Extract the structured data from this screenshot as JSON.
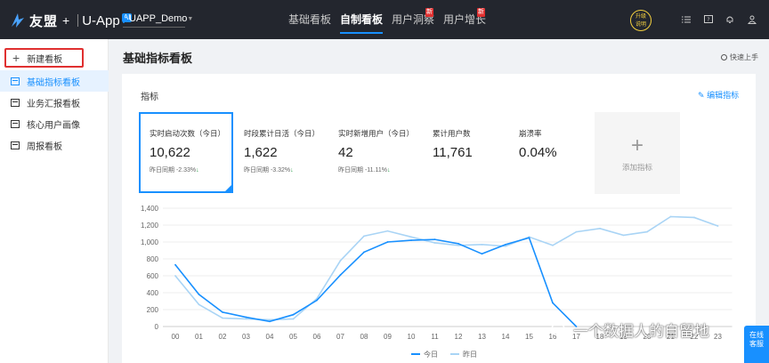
{
  "header": {
    "brand": "友盟",
    "plus": "+",
    "product": "U-App",
    "ai_badge": "AI",
    "app_selector": "UAPP_Demo",
    "nav": [
      {
        "label": "基础看板",
        "active": false,
        "new": false
      },
      {
        "label": "自制看板",
        "active": true,
        "new": false
      },
      {
        "label": "用户洞察",
        "active": false,
        "new": true
      },
      {
        "label": "用户增长",
        "active": false,
        "new": true
      }
    ],
    "new_badge": "新",
    "upgrade_line1": "升级",
    "upgrade_line2": "说明",
    "icons": [
      "list-icon",
      "help-icon",
      "bell-icon",
      "user-icon"
    ]
  },
  "sidebar": {
    "new_board": "新建看板",
    "items": [
      {
        "label": "基础指标看板",
        "active": true
      },
      {
        "label": "业务汇报看板",
        "active": false
      },
      {
        "label": "核心用户画像",
        "active": false
      },
      {
        "label": "周报看板",
        "active": false
      }
    ]
  },
  "main": {
    "title": "基础指标看板",
    "quick_start": "快速上手",
    "section_label": "指标",
    "edit_label": "编辑指标",
    "add_metric": "添加指标",
    "metrics": [
      {
        "name": "实时启动次数（今日）",
        "value": "10,622",
        "cmp_label": "昨日同期",
        "cmp_value": "-2.33%",
        "selected": true
      },
      {
        "name": "时段累计日活（今日）",
        "value": "1,622",
        "cmp_label": "昨日同期",
        "cmp_value": "-3.32%",
        "selected": false
      },
      {
        "name": "实时新增用户（今日）",
        "value": "42",
        "cmp_label": "昨日同期",
        "cmp_value": "-11.11%",
        "selected": false
      },
      {
        "name": "累计用户数",
        "value": "11,761",
        "cmp_label": "",
        "cmp_value": "",
        "selected": false
      },
      {
        "name": "崩溃率",
        "value": "0.04%",
        "cmp_label": "",
        "cmp_value": "",
        "selected": false
      }
    ]
  },
  "chart_data": {
    "type": "line",
    "categories": [
      "00",
      "01",
      "02",
      "03",
      "04",
      "05",
      "06",
      "07",
      "08",
      "09",
      "10",
      "11",
      "12",
      "13",
      "14",
      "15",
      "16",
      "17",
      "18",
      "19",
      "20",
      "21",
      "22",
      "23"
    ],
    "y_ticks": [
      0,
      200,
      400,
      600,
      800,
      1000,
      1200,
      1400
    ],
    "ylim": [
      0,
      1400
    ],
    "grid": true,
    "legend_position": "bottom",
    "series": [
      {
        "name": "今日",
        "color": "#1890ff",
        "values": [
          730,
          380,
          170,
          110,
          60,
          140,
          310,
          610,
          880,
          1000,
          1020,
          1030,
          980,
          860,
          970,
          1050,
          280,
          0,
          null,
          null,
          null,
          null,
          null,
          null
        ]
      },
      {
        "name": "昨日",
        "color": "#a9d4f5",
        "values": [
          600,
          260,
          100,
          90,
          80,
          90,
          330,
          780,
          1070,
          1130,
          1060,
          990,
          960,
          970,
          950,
          1060,
          960,
          1120,
          1160,
          1080,
          1120,
          1300,
          1290,
          1190
        ]
      }
    ]
  },
  "watermark": "一个数据人的自留地",
  "online_service": [
    "在线",
    "客服"
  ]
}
